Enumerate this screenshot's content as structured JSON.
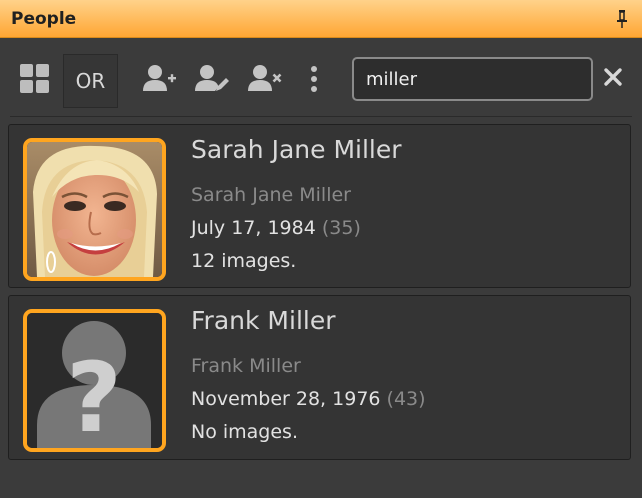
{
  "panel": {
    "title": "People",
    "pin_icon": "pin-icon",
    "accent_color": "#ffa51f"
  },
  "toolbar": {
    "view_icon": "grid-view-icon",
    "or_label": "OR",
    "add_icon": "add-person-icon",
    "edit_icon": "edit-person-icon",
    "remove_icon": "remove-person-icon",
    "more_icon": "more-vertical-icon",
    "search_value": "miller",
    "clear_icon": "close-icon"
  },
  "people": [
    {
      "name": "Sarah Jane Miller",
      "alias": "Sarah Jane Miller",
      "birthdate": "July 17, 1984",
      "age": "(35)",
      "images": "12 images.",
      "avatar": "photo"
    },
    {
      "name": "Frank Miller",
      "alias": "Frank Miller",
      "birthdate": "November 28, 1976",
      "age": "(43)",
      "images": "No images.",
      "avatar": "unknown-person-icon"
    }
  ]
}
